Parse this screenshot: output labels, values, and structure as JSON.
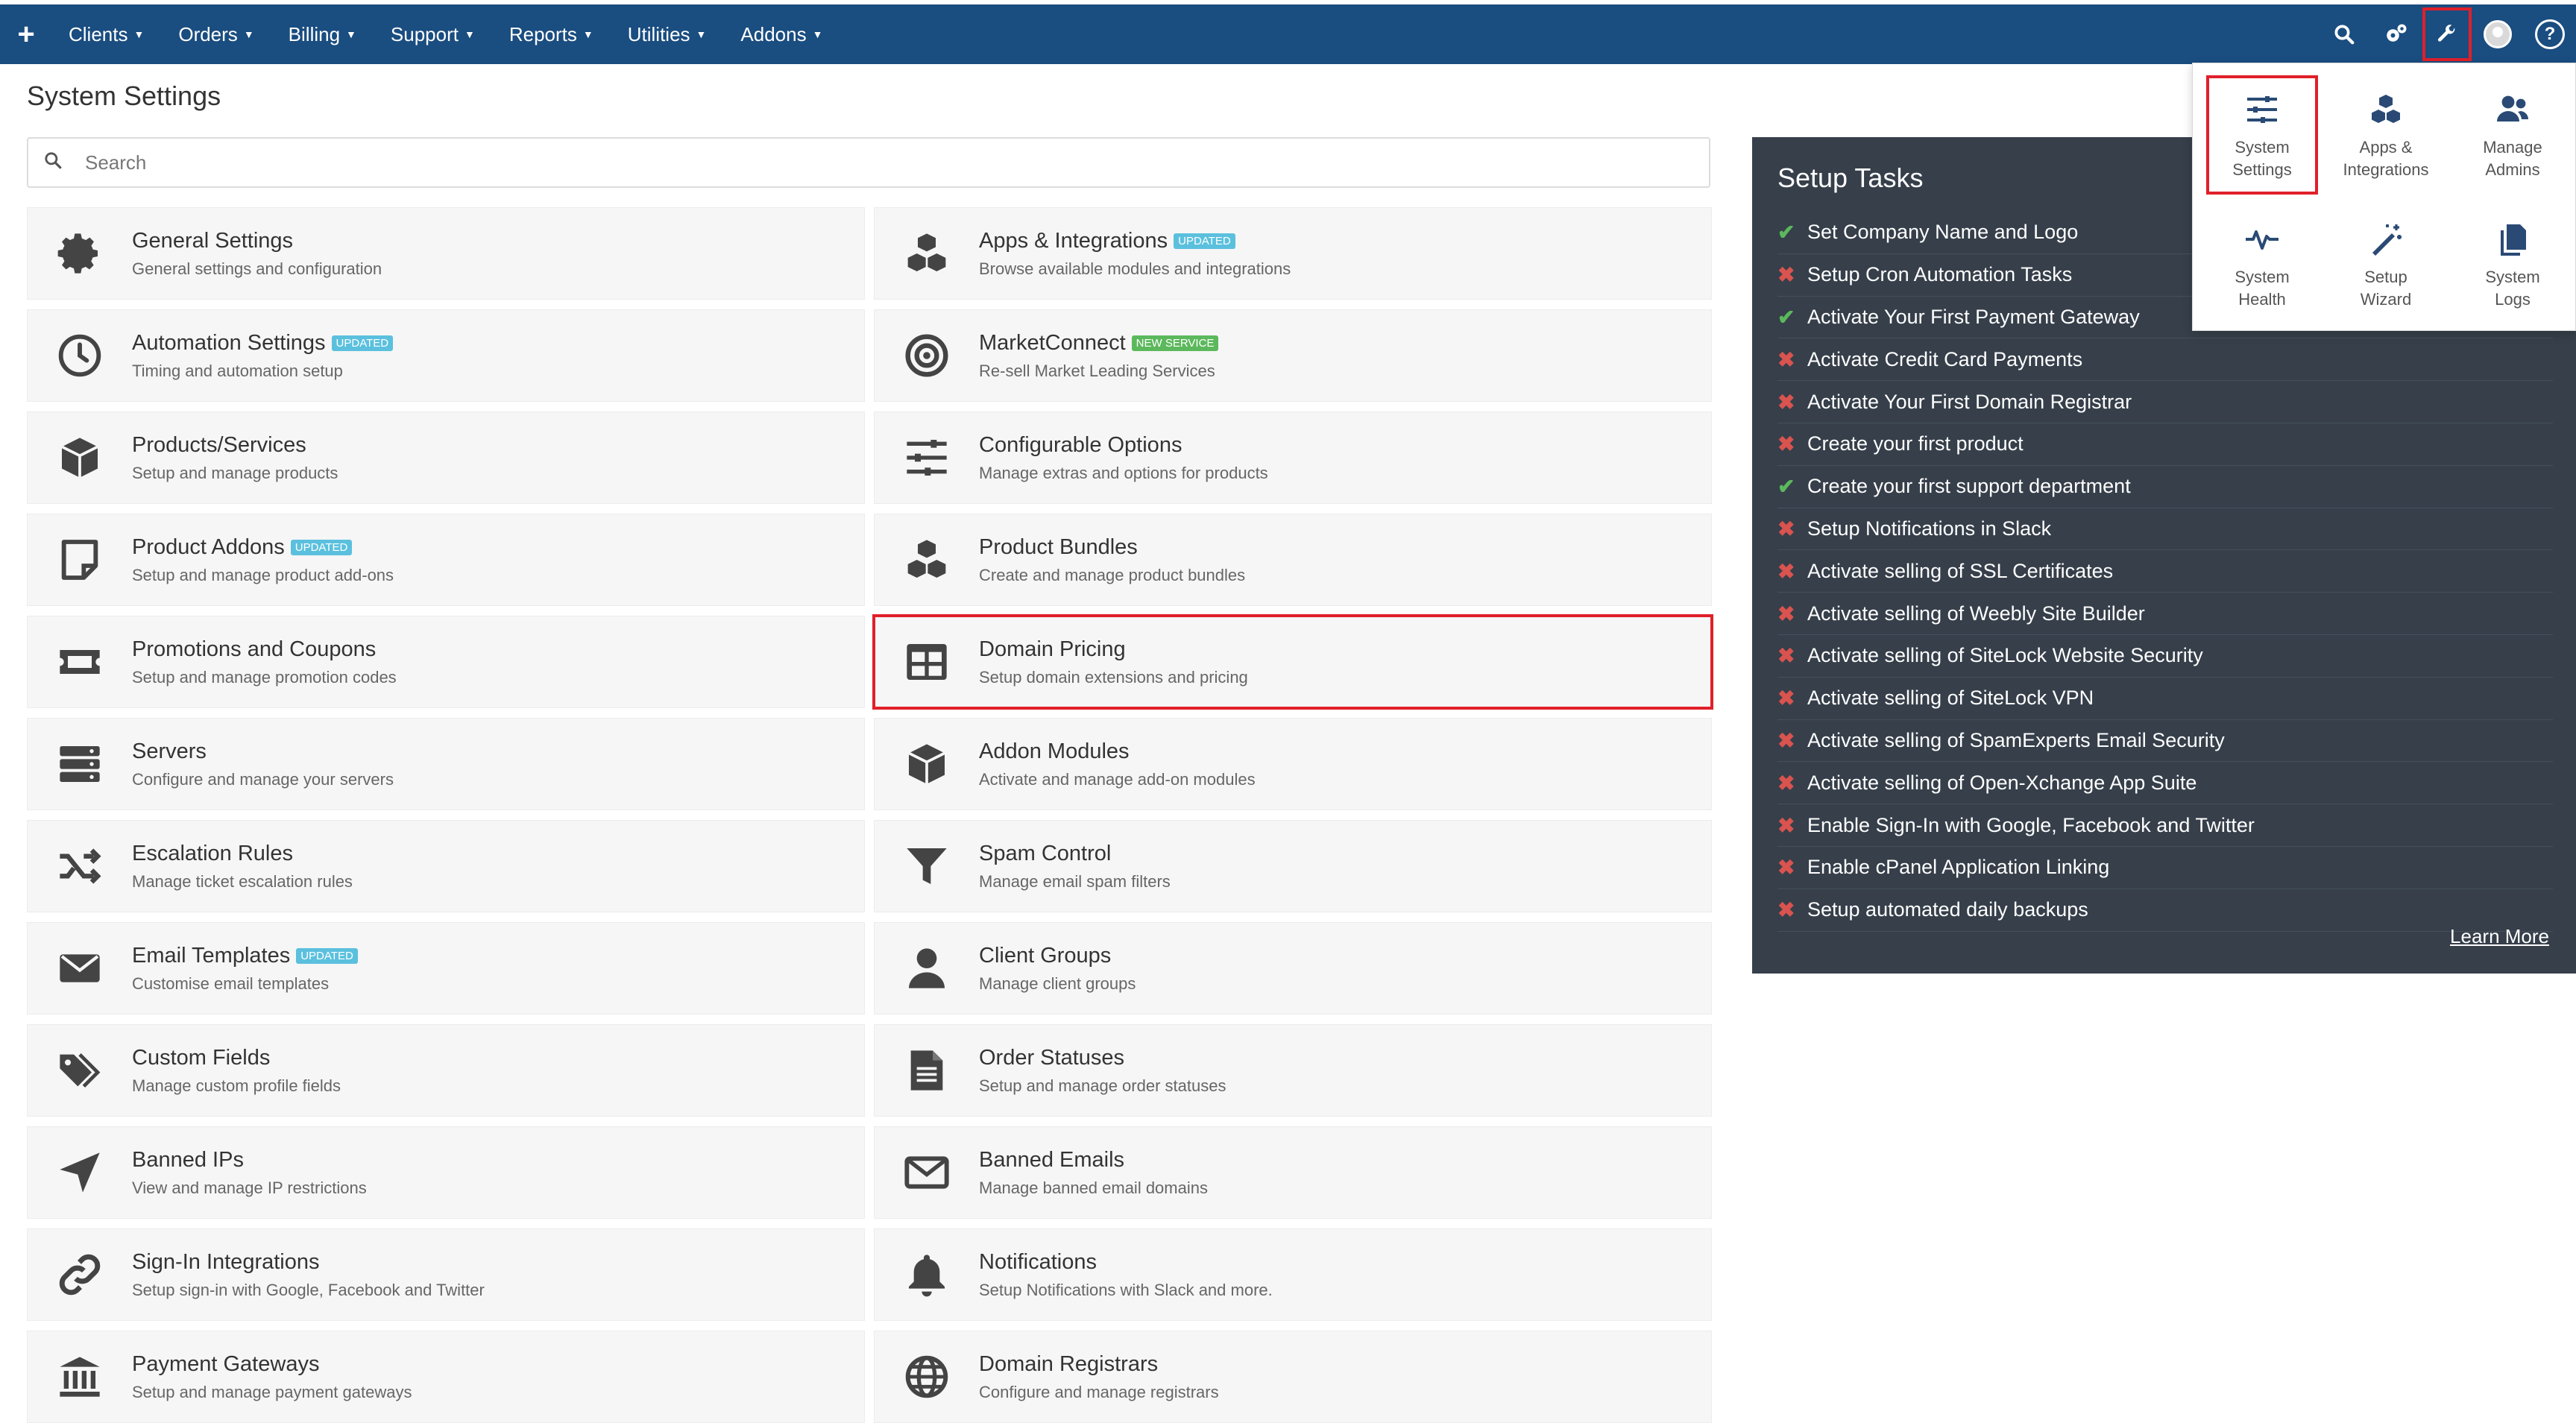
{
  "navbar": {
    "add_symbol": "+",
    "menu": [
      "Clients",
      "Orders",
      "Billing",
      "Support",
      "Reports",
      "Utilities",
      "Addons"
    ]
  },
  "page_title": "System Settings",
  "search": {
    "placeholder": "Search"
  },
  "cards_left": [
    {
      "title": "General Settings",
      "desc": "General settings and configuration",
      "icon": "gear-icon"
    },
    {
      "title": "Automation Settings",
      "badge": "UPDATED",
      "desc": "Timing and automation setup",
      "icon": "clock-icon"
    },
    {
      "title": "Products/Services",
      "desc": "Setup and manage products",
      "icon": "box-icon"
    },
    {
      "title": "Product Addons",
      "badge": "UPDATED",
      "desc": "Setup and manage product add-ons",
      "icon": "sticky-note-icon"
    },
    {
      "title": "Promotions and Coupons",
      "desc": "Setup and manage promotion codes",
      "icon": "ticket-icon"
    },
    {
      "title": "Servers",
      "desc": "Configure and manage your servers",
      "icon": "server-icon"
    },
    {
      "title": "Escalation Rules",
      "desc": "Manage ticket escalation rules",
      "icon": "shuffle-icon"
    },
    {
      "title": "Email Templates",
      "badge": "UPDATED",
      "desc": "Customise email templates",
      "icon": "envelope-icon"
    },
    {
      "title": "Custom Fields",
      "desc": "Manage custom profile fields",
      "icon": "tags-icon"
    },
    {
      "title": "Banned IPs",
      "desc": "View and manage IP restrictions",
      "icon": "location-arrow-icon"
    },
    {
      "title": "Sign-In Integrations",
      "desc": "Setup sign-in with Google, Facebook and Twitter",
      "icon": "link-icon"
    },
    {
      "title": "Payment Gateways",
      "desc": "Setup and manage payment gateways",
      "icon": "bank-icon"
    }
  ],
  "cards_right": [
    {
      "title": "Apps & Integrations",
      "badge": "UPDATED",
      "desc": "Browse available modules and integrations",
      "icon": "cubes-icon"
    },
    {
      "title": "MarketConnect",
      "badge_new": "NEW SERVICE",
      "desc": "Re-sell Market Leading Services",
      "icon": "target-icon"
    },
    {
      "title": "Configurable Options",
      "desc": "Manage extras and options for products",
      "icon": "sliders-icon"
    },
    {
      "title": "Product Bundles",
      "desc": "Create and manage product bundles",
      "icon": "cubes-icon"
    },
    {
      "title": "Domain Pricing",
      "desc": "Setup domain extensions and pricing",
      "icon": "table-icon"
    },
    {
      "title": "Addon Modules",
      "desc": "Activate and manage add-on modules",
      "icon": "cube-icon"
    },
    {
      "title": "Spam Control",
      "desc": "Manage email spam filters",
      "icon": "filter-icon"
    },
    {
      "title": "Client Groups",
      "desc": "Manage client groups",
      "icon": "user-icon"
    },
    {
      "title": "Order Statuses",
      "desc": "Setup and manage order statuses",
      "icon": "file-icon"
    },
    {
      "title": "Banned Emails",
      "desc": "Manage banned email domains",
      "icon": "envelope-outline-icon"
    },
    {
      "title": "Notifications",
      "desc": "Setup Notifications with Slack and more.",
      "icon": "bell-icon"
    },
    {
      "title": "Domain Registrars",
      "desc": "Configure and manage registrars",
      "icon": "globe-icon"
    }
  ],
  "setup_tasks": {
    "title": "Setup Tasks",
    "items": [
      {
        "label": "Set Company Name and Logo",
        "done": true
      },
      {
        "label": "Setup Cron Automation Tasks",
        "done": false
      },
      {
        "label": "Activate Your First Payment Gateway",
        "done": true
      },
      {
        "label": "Activate Credit Card Payments",
        "done": false
      },
      {
        "label": "Activate Your First Domain Registrar",
        "done": false
      },
      {
        "label": "Create your first product",
        "done": false
      },
      {
        "label": "Create your first support department",
        "done": true
      },
      {
        "label": "Setup Notifications in Slack",
        "done": false
      },
      {
        "label": "Activate selling of SSL Certificates",
        "done": false
      },
      {
        "label": "Activate selling of Weebly Site Builder",
        "done": false
      },
      {
        "label": "Activate selling of SiteLock Website Security",
        "done": false
      },
      {
        "label": "Activate selling of SiteLock VPN",
        "done": false
      },
      {
        "label": "Activate selling of SpamExperts Email Security",
        "done": false
      },
      {
        "label": "Activate selling of Open-Xchange App Suite",
        "done": false
      },
      {
        "label": "Enable Sign-In with Google, Facebook and Twitter",
        "done": false
      },
      {
        "label": "Enable cPanel Application Linking",
        "done": false
      },
      {
        "label": "Setup automated daily backups",
        "done": false
      }
    ],
    "learn_more": "Learn More"
  },
  "dropdown": {
    "items": [
      {
        "line1": "System",
        "line2": "Settings",
        "icon": "sliders-icon"
      },
      {
        "line1": "Apps &",
        "line2": "Integrations",
        "icon": "cubes-icon"
      },
      {
        "line1": "Manage",
        "line2": "Admins",
        "icon": "users-icon"
      },
      {
        "line1": "System",
        "line2": "Health",
        "icon": "heartbeat-icon"
      },
      {
        "line1": "Setup",
        "line2": "Wizard",
        "icon": "magic-wand-icon"
      },
      {
        "line1": "System",
        "line2": "Logs",
        "icon": "copy-icon"
      }
    ]
  },
  "colors": {
    "navbar": "#1a4d80",
    "setup_panel": "#363f4a",
    "highlight": "#e0202a",
    "badge_updated": "#5bc0de",
    "badge_new": "#5cb85c"
  }
}
